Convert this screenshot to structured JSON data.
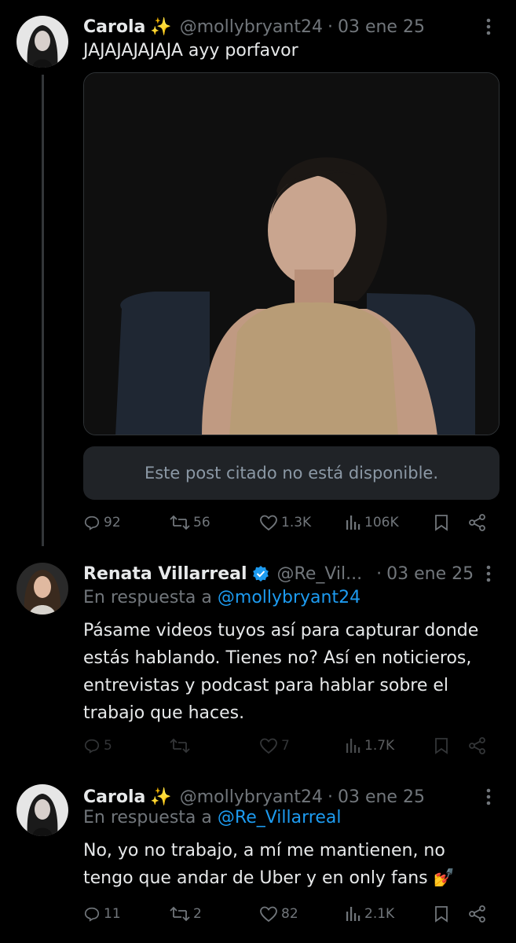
{
  "posts": [
    {
      "name": "Carola",
      "emoji": "✨",
      "handle": "@mollybryant24",
      "date": "03 ene 25",
      "text": "JAJAJAJAJAJA ayy porfavor",
      "quote_unavailable": "Este post citado no está disponible.",
      "stats": {
        "replies": "92",
        "reposts": "56",
        "likes": "1.3K",
        "views": "106K"
      }
    },
    {
      "name": "Renata Villarreal",
      "handle": "@Re_Vil...",
      "date": "03 ene 25",
      "reply_prefix": "En respuesta a",
      "reply_to": "@mollybryant24",
      "text": "Pásame videos tuyos así para capturar donde estás hablando. Tienes no? Así en noticieros, entrevistas y podcast para hablar sobre el trabajo que haces.",
      "stats": {
        "replies": "5",
        "reposts": "",
        "likes": "7",
        "views": "1.7K"
      }
    },
    {
      "name": "Carola",
      "emoji": "✨",
      "handle": "@mollybryant24",
      "date": "03 ene 25",
      "reply_prefix": "En respuesta a",
      "reply_to": "@Re_Villarreal",
      "text": "No, yo no trabajo, a mí me mantienen, no tengo que andar de Uber y en only fans 💅",
      "stats": {
        "replies": "11",
        "reposts": "2",
        "likes": "82",
        "views": "2.1K"
      }
    }
  ],
  "colors": {
    "background": "#000000",
    "text": "#e7e9ea",
    "muted": "#71767b",
    "link": "#1d9bf0"
  },
  "icons": [
    "reply-icon",
    "repost-icon",
    "like-icon",
    "views-icon",
    "bookmark-icon",
    "share-icon",
    "more-icon",
    "verified-badge-icon"
  ]
}
